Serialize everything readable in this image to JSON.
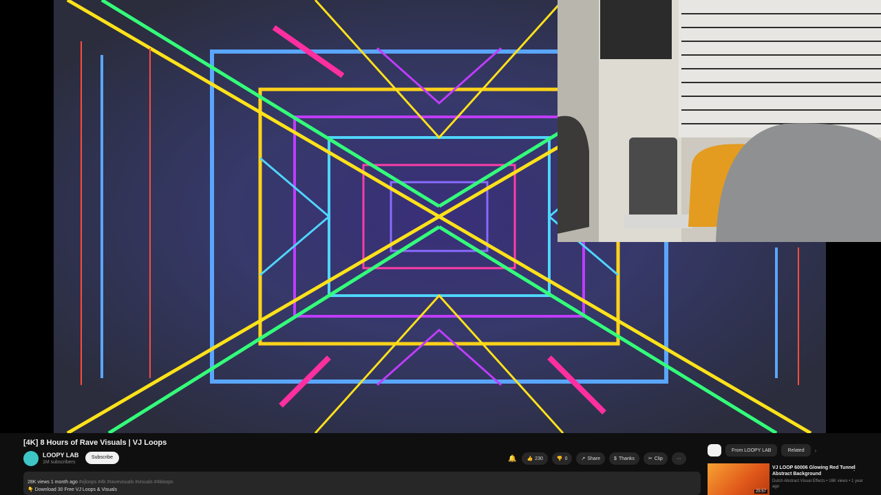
{
  "video": {
    "title": "[4K] 8 Hours of Rave Visuals | VJ Loops",
    "channel_name": "LOOPY LAB",
    "subscribers": "1M subscribers",
    "subscribe_label": "Subscribe",
    "like_count": "230",
    "dislike_label": "0",
    "share_label": "Share",
    "thanks_label": "Thanks",
    "clip_label": "Clip",
    "more_label": "···"
  },
  "description": {
    "stats": "28K views  1 month ago",
    "tags": "#vjloops #4k #ravevisuals #visuals #4kloops",
    "line2": "👇 Download 30 Free VJ Loops & Visuals"
  },
  "sidebar": {
    "chips": [
      "From LOOPY LAB",
      "Related"
    ],
    "next_video": {
      "title": "VJ LOOP 60006 Glowing Red Tunnel Abstract Background",
      "meta": "Dutch Abstract Visual Effects • 16K views • 1 year ago",
      "duration": "25:57"
    }
  },
  "colors": {
    "accent_teal": "#3ec6c6",
    "background": "#0f0f0f"
  }
}
